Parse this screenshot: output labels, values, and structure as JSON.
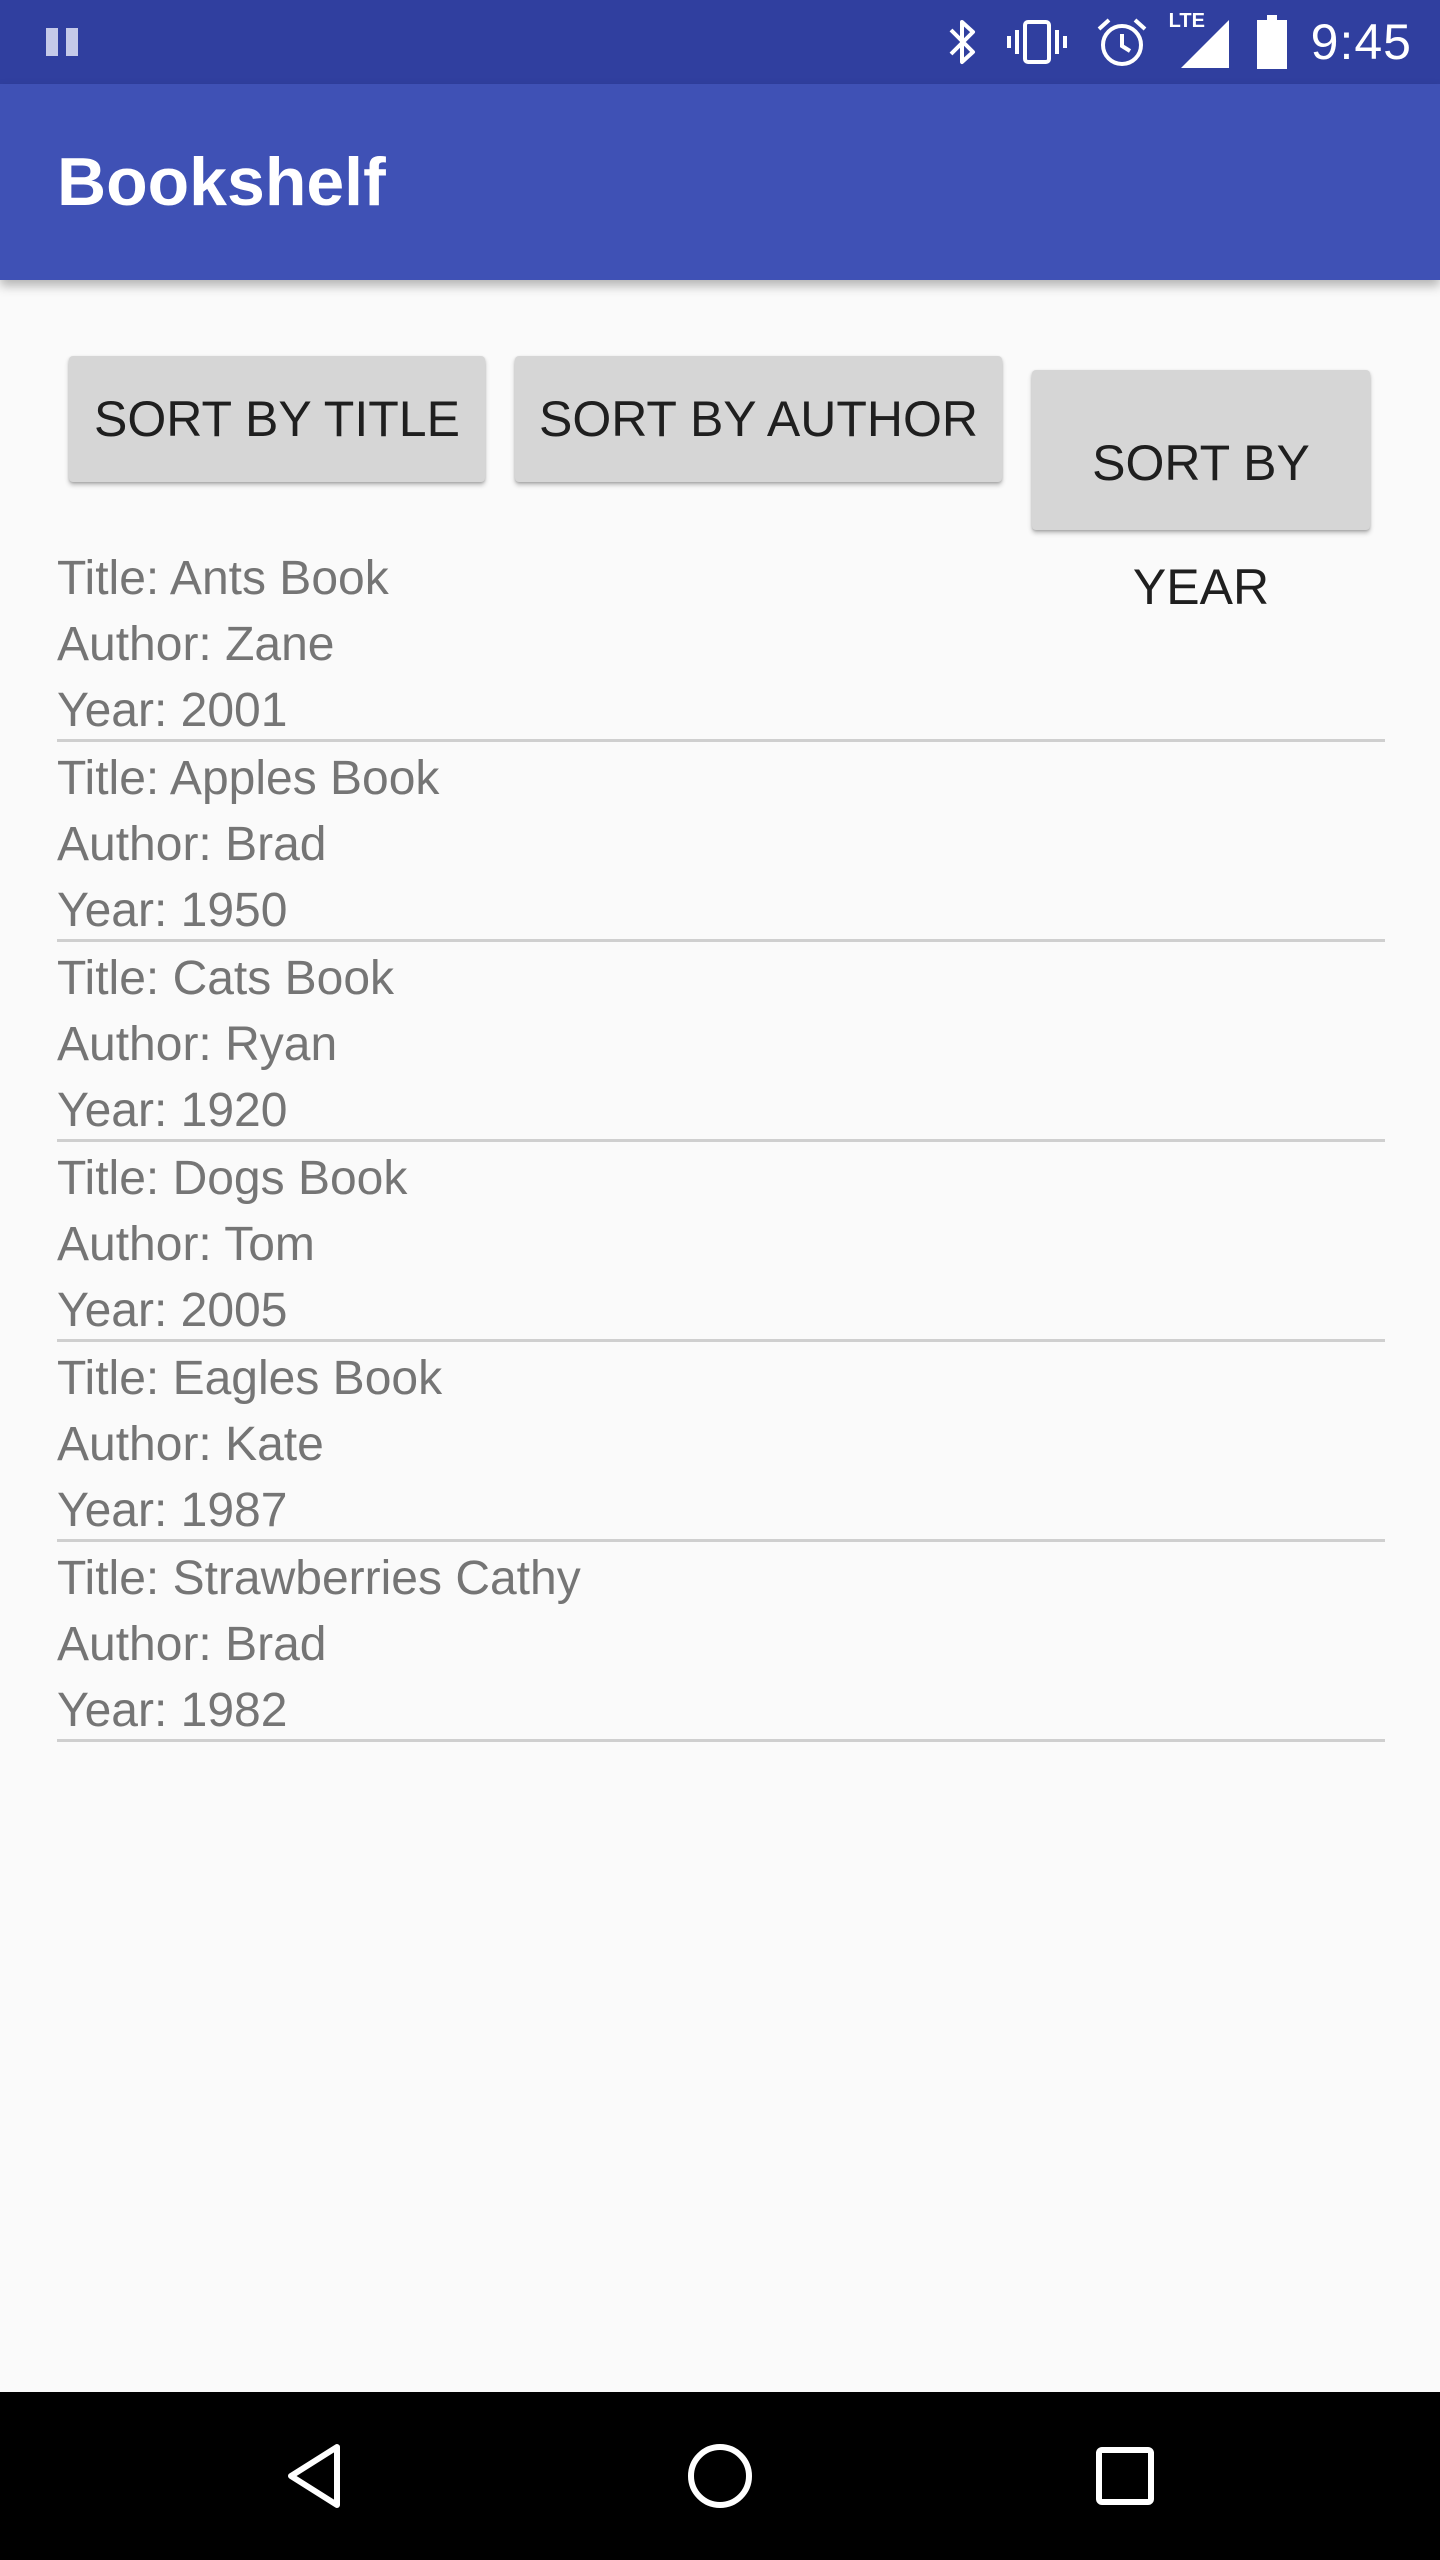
{
  "status_bar": {
    "time": "9:45",
    "network_label": "LTE",
    "icons": [
      "pause-icon",
      "bluetooth-icon",
      "vibrate-icon",
      "alarm-icon",
      "lte-signal-icon",
      "battery-icon"
    ]
  },
  "app_bar": {
    "title": "Bookshelf",
    "color": "#3f51b5",
    "status_color": "#303f9f"
  },
  "buttons": {
    "sort_title": "SORT BY TITLE",
    "sort_author": "SORT BY AUTHOR",
    "sort_year_line1": "SORT BY",
    "sort_year_line2": "YEAR"
  },
  "books": [
    {
      "title": "Title: Ants Book",
      "author": "Author: Zane",
      "year": "Year: 2001"
    },
    {
      "title": "Title: Apples Book",
      "author": "Author: Brad",
      "year": "Year: 1950"
    },
    {
      "title": "Title: Cats Book",
      "author": "Author: Ryan",
      "year": "Year: 1920"
    },
    {
      "title": "Title: Dogs Book",
      "author": "Author: Tom",
      "year": "Year: 2005"
    },
    {
      "title": "Title: Eagles Book",
      "author": "Author: Kate",
      "year": "Year: 1987"
    },
    {
      "title": "Title: Strawberries Cathy",
      "author": "Author: Brad",
      "year": "Year: 1982"
    }
  ],
  "nav_bar": {
    "icons": [
      "back-icon",
      "home-icon",
      "recents-icon"
    ]
  }
}
